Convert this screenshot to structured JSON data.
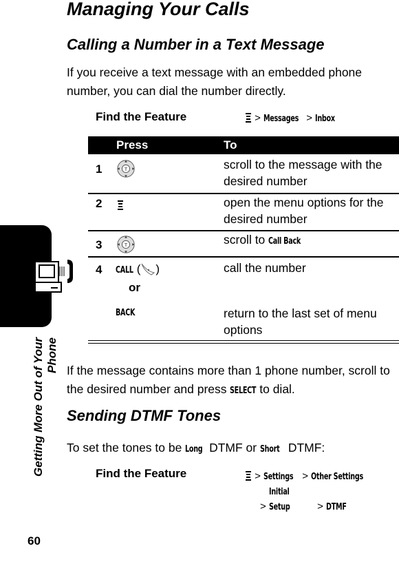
{
  "page": {
    "title": "Managing Your Calls",
    "number": "60",
    "side_tab": {
      "line1": "Getting More Out of Your",
      "line2": "Phone"
    }
  },
  "section1": {
    "heading": "Calling a Number in a Text Message",
    "intro": "If you receive a text message with an embedded phone number, you can dial the number directly.",
    "find_feature": {
      "label": "Find the Feature",
      "sep": ">",
      "items": [
        "Messages",
        "Inbox"
      ]
    },
    "table": {
      "headers": [
        "Press",
        "To"
      ],
      "rows": [
        {
          "num": "1",
          "press_icon": "nav-key-icon",
          "to": "scroll to the message with the desired number"
        },
        {
          "num": "2",
          "press_icon": "menu-key-icon",
          "to": "open the menu options for the desired number"
        },
        {
          "num": "3",
          "press_icon": "nav-key-icon",
          "to_prefix": "scroll to ",
          "to_key": "Call Back"
        },
        {
          "num": "4",
          "press_key": "CALL",
          "press_paren_open": "(",
          "press_paren_close": ")",
          "press_icon": "send-key-icon",
          "to": "call the number",
          "or": "or",
          "alt_key": "BACK",
          "alt_to": "return to the last set of menu options"
        }
      ]
    },
    "after_1": "If the message contains more than 1 phone number, scroll to the desired number and press ",
    "after_key": "SELECT",
    "after_2": " to dial."
  },
  "section2": {
    "heading": "Sending DTMF Tones",
    "intro_1": "To set the tones to be ",
    "key_long": "Long",
    "intro_2": " DTMF or ",
    "key_short": "Short",
    "intro_3": " DTMF:",
    "find_feature": {
      "label": "Find the Feature",
      "sep": ">",
      "items": [
        "Settings",
        "Other Settings",
        "Initial Setup",
        "DTMF"
      ]
    }
  }
}
